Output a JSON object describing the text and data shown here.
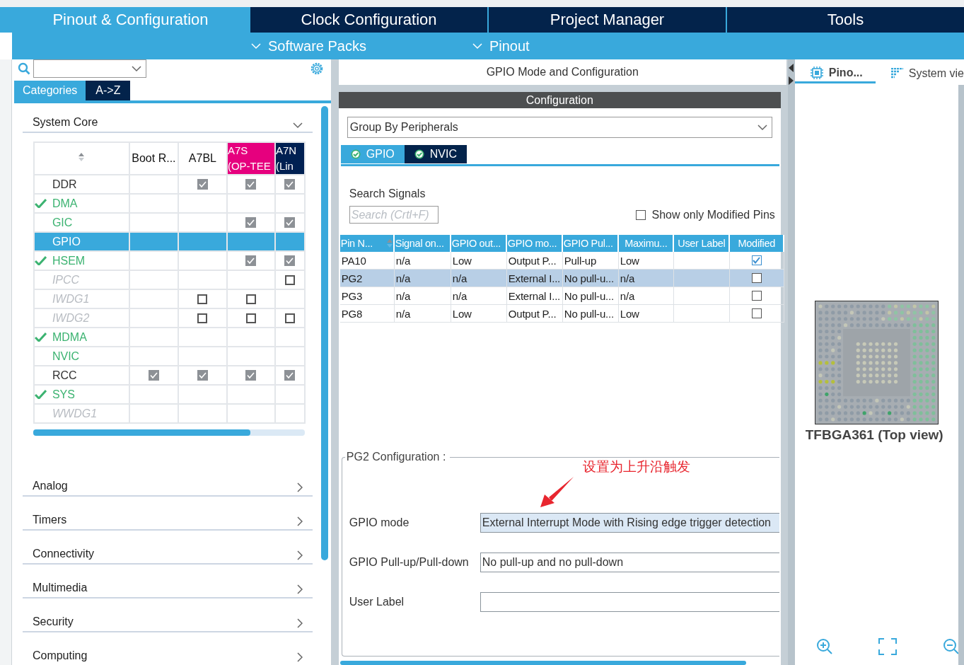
{
  "top_tabs": [
    {
      "label": "Pinout & Configuration",
      "selected": true
    },
    {
      "label": "Clock Configuration",
      "selected": false
    },
    {
      "label": "Project Manager",
      "selected": false
    },
    {
      "label": "Tools",
      "selected": false
    }
  ],
  "menus": [
    {
      "label": "Software Packs"
    },
    {
      "label": "Pinout"
    }
  ],
  "left": {
    "view_tabs": [
      {
        "label": "Categories",
        "selected": true
      },
      {
        "label": "A->Z",
        "selected": false
      }
    ],
    "category": {
      "title": "System Core",
      "expanded": true
    },
    "columns": [
      {
        "label": "Boot R..."
      },
      {
        "label": "A7BL"
      },
      {
        "label": "A7S\n(OP-TEE",
        "color": "#e6007e"
      },
      {
        "label": "A7N\n(Lin",
        "color": "#002052"
      }
    ],
    "rows": [
      {
        "name": "DDR",
        "kind": "normal",
        "ok": false,
        "selected": false,
        "cells": [
          {
            "kind": "empty"
          },
          {
            "kind": "checkbox",
            "checked": true
          },
          {
            "kind": "checkbox",
            "checked": true
          },
          {
            "kind": "checkbox",
            "checked": true
          }
        ]
      },
      {
        "name": "DMA",
        "kind": "configured",
        "ok": true,
        "selected": false,
        "cells": [
          {
            "kind": "empty"
          },
          {
            "kind": "empty"
          },
          {
            "kind": "empty"
          },
          {
            "kind": "empty"
          }
        ]
      },
      {
        "name": "GIC",
        "kind": "configured",
        "ok": false,
        "selected": false,
        "cells": [
          {
            "kind": "empty"
          },
          {
            "kind": "empty"
          },
          {
            "kind": "checkbox",
            "checked": true
          },
          {
            "kind": "checkbox",
            "checked": true
          }
        ]
      },
      {
        "name": "GPIO",
        "kind": "normal",
        "ok": false,
        "selected": true,
        "cells": [
          {
            "kind": "empty"
          },
          {
            "kind": "empty"
          },
          {
            "kind": "empty"
          },
          {
            "kind": "empty"
          }
        ]
      },
      {
        "name": "HSEM",
        "kind": "configured",
        "ok": true,
        "selected": false,
        "cells": [
          {
            "kind": "empty"
          },
          {
            "kind": "empty"
          },
          {
            "kind": "checkbox",
            "checked": true
          },
          {
            "kind": "checkbox",
            "checked": true
          }
        ]
      },
      {
        "name": "IPCC",
        "kind": "unavailable",
        "ok": false,
        "selected": false,
        "cells": [
          {
            "kind": "empty"
          },
          {
            "kind": "empty"
          },
          {
            "kind": "empty"
          },
          {
            "kind": "checkbox",
            "checked": false
          }
        ]
      },
      {
        "name": "IWDG1",
        "kind": "unavailable",
        "ok": false,
        "selected": false,
        "cells": [
          {
            "kind": "empty"
          },
          {
            "kind": "checkbox",
            "checked": false
          },
          {
            "kind": "checkbox",
            "checked": false
          },
          {
            "kind": "empty"
          }
        ]
      },
      {
        "name": "IWDG2",
        "kind": "unavailable",
        "ok": false,
        "selected": false,
        "cells": [
          {
            "kind": "empty"
          },
          {
            "kind": "checkbox",
            "checked": false
          },
          {
            "kind": "checkbox",
            "checked": false
          },
          {
            "kind": "checkbox",
            "checked": false
          }
        ]
      },
      {
        "name": "MDMA",
        "kind": "configured",
        "ok": true,
        "selected": false,
        "cells": [
          {
            "kind": "empty"
          },
          {
            "kind": "empty"
          },
          {
            "kind": "empty"
          },
          {
            "kind": "empty"
          }
        ]
      },
      {
        "name": "NVIC",
        "kind": "configured",
        "ok": false,
        "selected": false,
        "cells": [
          {
            "kind": "empty"
          },
          {
            "kind": "empty"
          },
          {
            "kind": "empty"
          },
          {
            "kind": "empty"
          }
        ]
      },
      {
        "name": "RCC",
        "kind": "normal",
        "ok": false,
        "selected": false,
        "cells": [
          {
            "kind": "checkbox",
            "checked": true
          },
          {
            "kind": "checkbox",
            "checked": true
          },
          {
            "kind": "checkbox",
            "checked": true
          },
          {
            "kind": "checkbox",
            "checked": true
          }
        ]
      },
      {
        "name": "SYS",
        "kind": "configured",
        "ok": true,
        "selected": false,
        "cells": [
          {
            "kind": "empty"
          },
          {
            "kind": "empty"
          },
          {
            "kind": "empty"
          },
          {
            "kind": "empty"
          }
        ]
      },
      {
        "name": "WWDG1",
        "kind": "unavailable",
        "ok": false,
        "selected": false,
        "cells": [
          {
            "kind": "empty"
          },
          {
            "kind": "empty"
          },
          {
            "kind": "empty"
          },
          {
            "kind": "empty"
          }
        ]
      }
    ],
    "categories": [
      {
        "title": "Analog",
        "expanded": false
      },
      {
        "title": "Timers",
        "expanded": false
      },
      {
        "title": "Connectivity",
        "expanded": false
      },
      {
        "title": "Multimedia",
        "expanded": false
      },
      {
        "title": "Security",
        "expanded": false
      },
      {
        "title": "Computing",
        "expanded": false
      }
    ]
  },
  "mode_panel": {
    "title": "GPIO Mode and Configuration",
    "section": "Configuration",
    "group_by": "Group By Peripherals",
    "tabs": [
      {
        "label": "GPIO",
        "selected": true
      },
      {
        "label": "NVIC",
        "selected": false
      }
    ],
    "search": {
      "label": "Search Signals",
      "placeholder": "Search (Crtl+F)"
    },
    "show_modified": {
      "label": "Show only Modified Pins",
      "checked": false
    },
    "pin_table": {
      "columns": [
        "Pin N...",
        "Signal on...",
        "GPIO out...",
        "GPIO mo...",
        "GPIO Pul...",
        "Maximu...",
        "User Label",
        "Modified"
      ],
      "rows": [
        {
          "cells": [
            "PA10",
            "n/a",
            "Low",
            "Output P...",
            "Pull-up",
            "Low"
          ],
          "modified": true,
          "selected": false
        },
        {
          "cells": [
            "PG2",
            "n/a",
            "n/a",
            "External I...",
            "No pull-u...",
            "n/a"
          ],
          "modified": false,
          "selected": true
        },
        {
          "cells": [
            "PG3",
            "n/a",
            "n/a",
            "External I...",
            "No pull-u...",
            "n/a"
          ],
          "modified": false,
          "selected": false
        },
        {
          "cells": [
            "PG8",
            "n/a",
            "Low",
            "Output P...",
            "No pull-u...",
            "Low"
          ],
          "modified": false,
          "selected": false
        }
      ]
    },
    "pin_config": {
      "title": "PG2 Configuration :",
      "annotation": "设置为上升沿触发",
      "fields": [
        {
          "label": "GPIO mode",
          "value": "External Interrupt Mode with Rising edge trigger detection",
          "highlighted": true
        },
        {
          "label": "GPIO Pull-up/Pull-down",
          "value": "No pull-up and no pull-down",
          "highlighted": false
        },
        {
          "label": "User Label",
          "highlighted": false
        }
      ]
    }
  },
  "right": {
    "view_tabs": [
      {
        "label": "Pino...",
        "selected": true
      },
      {
        "label": "System vie",
        "selected": false
      }
    ],
    "package": "TFBGA361 (Top view)"
  }
}
